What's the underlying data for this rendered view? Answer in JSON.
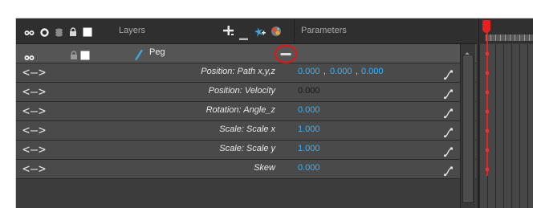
{
  "header": {
    "layers_label": "Layers",
    "parameters_label": "Parameters",
    "icons": [
      "eye-icon",
      "circle-icon",
      "stack-icon",
      "lock-icon",
      "square-icon",
      "add-layer-icon",
      "remove-layer-icon",
      "add-peg-icon",
      "effect-icon"
    ]
  },
  "peg_row": {
    "name": "Peg",
    "collapse_label": "—",
    "icons": [
      "eye-icon",
      "lock-icon",
      "square-icon",
      "peg-icon",
      "collapse-icon"
    ]
  },
  "params": [
    {
      "arrows": "<—>",
      "name": "Position: Path x,y,z",
      "values": [
        "0.000",
        "0.000",
        "0.000"
      ]
    },
    {
      "arrows": "<—>",
      "name": "Position: Velocity",
      "values": [
        "0.000"
      ]
    },
    {
      "arrows": "<—>",
      "name": "Rotation: Angle_z",
      "values": [
        "0.000"
      ]
    },
    {
      "arrows": "<—>",
      "name": "Scale: Scale x",
      "values": [
        "1.000"
      ]
    },
    {
      "arrows": "<—>",
      "name": "Scale: Scale y",
      "values": [
        "1.000"
      ]
    },
    {
      "arrows": "<—>",
      "name": "Skew",
      "values": [
        "0.000"
      ]
    }
  ],
  "colors": {
    "value_color": "#35b4ff",
    "highlight_circle": "#e81212",
    "playhead": "#e82020"
  }
}
